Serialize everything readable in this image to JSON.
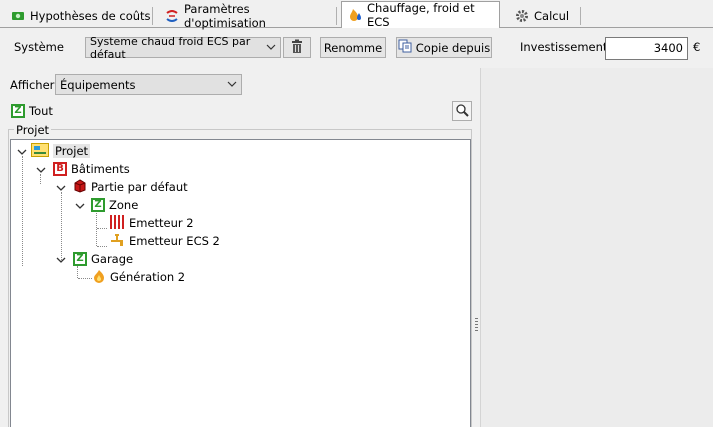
{
  "tabs": [
    {
      "label": "Hypothèses de coûts",
      "icon": "money-icon"
    },
    {
      "label": "Paramètres d'optimisation",
      "icon": "optimisation-icon"
    },
    {
      "label": "Chauffage, froid et ECS",
      "icon": "flame-water-icon",
      "active": true
    },
    {
      "label": "Calcul",
      "icon": "gear-icon"
    }
  ],
  "toolbar": {
    "system_label": "Système",
    "system_value": "Systeme chaud froid ECS par défaut",
    "rename_label": "Renomme",
    "copy_label": "Copie depuis",
    "investment_label": "Investissement",
    "investment_value": "3400",
    "currency": "€"
  },
  "filter": {
    "afficher_label": "Afficher",
    "afficher_value": "Équipements",
    "tout_label": "Tout"
  },
  "tree": {
    "group_title": "Projet",
    "root": "Projet",
    "batiments": "Bâtiments",
    "partie": "Partie par défaut",
    "zone": "Zone",
    "emetteur": "Emetteur 2",
    "emetteur_ecs": "Emetteur ECS 2",
    "garage": "Garage",
    "generation": "Génération 2"
  }
}
